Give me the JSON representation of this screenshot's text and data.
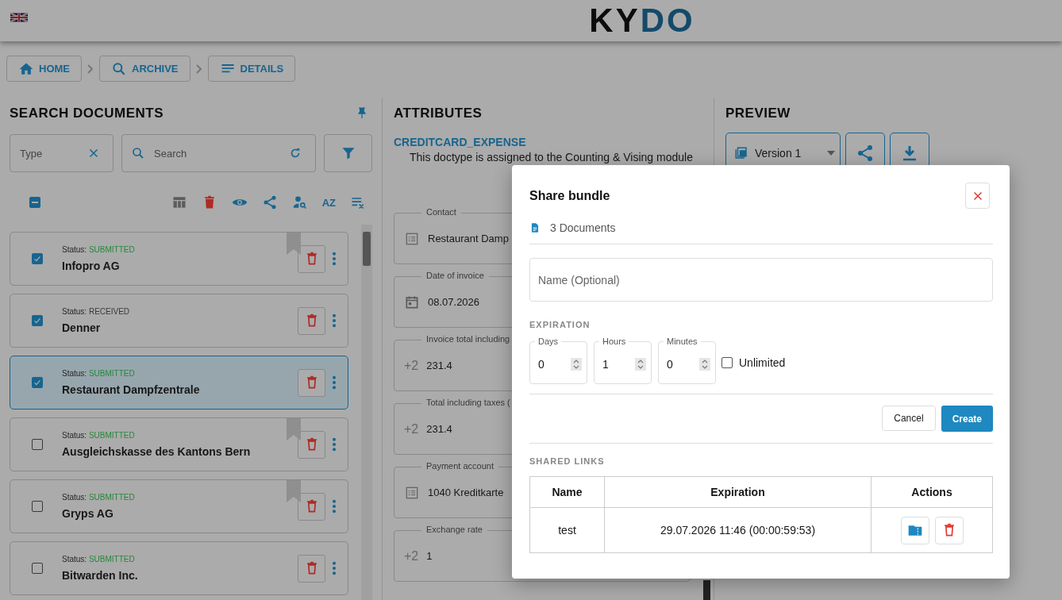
{
  "header": {
    "logo": [
      "KY",
      "DO"
    ]
  },
  "breadcrumbs": [
    {
      "label": "HOME"
    },
    {
      "label": "ARCHIVE"
    },
    {
      "label": "DETAILS"
    }
  ],
  "search_panel": {
    "title": "SEARCH DOCUMENTS",
    "type_field": {
      "placeholder": "Type"
    },
    "search_field": {
      "placeholder": "Search"
    },
    "select_all": {
      "indeterminate": true
    },
    "toolbar": [
      {
        "kind": "columns"
      },
      {
        "kind": "delete"
      },
      {
        "kind": "view"
      },
      {
        "kind": "share"
      },
      {
        "kind": "person-search"
      },
      {
        "kind": "sort",
        "text": "AZ"
      },
      {
        "kind": "clear"
      }
    ],
    "documents": [
      {
        "status_label": "Status:",
        "status": "SUBMITTED",
        "color": "#24883a",
        "name": "Infopro AG",
        "checked": true,
        "selected": false,
        "bookmarked": true
      },
      {
        "status_label": "Status:",
        "status": "RECEIVED",
        "color": "#393939",
        "name": "Denner",
        "checked": true,
        "selected": false,
        "bookmarked": false
      },
      {
        "status_label": "Status:",
        "status": "SUBMITTED",
        "color": "#24883a",
        "name": "Restaurant Dampfzentrale",
        "checked": true,
        "selected": true,
        "bookmarked": false
      },
      {
        "status_label": "Status:",
        "status": "SUBMITTED",
        "color": "#24883a",
        "name": "Ausgleichskasse des Kantons Bern",
        "checked": false,
        "selected": false,
        "bookmarked": true
      },
      {
        "status_label": "Status:",
        "status": "SUBMITTED",
        "color": "#24883a",
        "name": "Gryps AG",
        "checked": false,
        "selected": false,
        "bookmarked": true
      },
      {
        "status_label": "Status:",
        "status": "SUBMITTED",
        "color": "#24883a",
        "name": "Bitwarden Inc.",
        "checked": false,
        "selected": false,
        "bookmarked": false
      }
    ]
  },
  "attributes": {
    "title": "ATTRIBUTES",
    "doctype": "CREDITCARD_EXPENSE",
    "note": "This doctype is assigned to the Counting & Vising module",
    "fields": [
      {
        "kind": "list",
        "label": "Contact",
        "value": "Restaurant Damp"
      },
      {
        "kind": "date",
        "label": "Date of invoice",
        "value": "08.07.2026"
      },
      {
        "kind": "number",
        "prefix": "+2",
        "label": "Invoice total including",
        "value": "231.4"
      },
      {
        "kind": "number",
        "prefix": "+2",
        "label": "Total including taxes (",
        "value": "231.4"
      },
      {
        "kind": "list",
        "label": "Payment account",
        "value": "1040 Kreditkarte"
      },
      {
        "kind": "number",
        "prefix": "+2",
        "label": "Exchange rate",
        "value": "1"
      }
    ]
  },
  "preview": {
    "title": "PREVIEW",
    "version": "Version 1"
  },
  "dialog": {
    "title": "Share bundle",
    "documents": "3 Documents",
    "name_field": {
      "placeholder": "Name (Optional)"
    },
    "expiration_title": "EXPIRATION",
    "spinners": [
      {
        "label": "Days",
        "value": "0"
      },
      {
        "label": "Hours",
        "value": "1"
      },
      {
        "label": "Minutes",
        "value": "0"
      }
    ],
    "unlimited": {
      "label": "Unlimited",
      "checked": false
    },
    "cancel": "Cancel",
    "create": "Create",
    "shared_links": {
      "title": "SHARED LINKS",
      "columns": [
        "Name",
        "Expiration",
        "Actions"
      ],
      "rows": [
        {
          "name": "test",
          "expiration": "29.07.2026 11:46 (00:00:59:53)"
        }
      ]
    }
  }
}
